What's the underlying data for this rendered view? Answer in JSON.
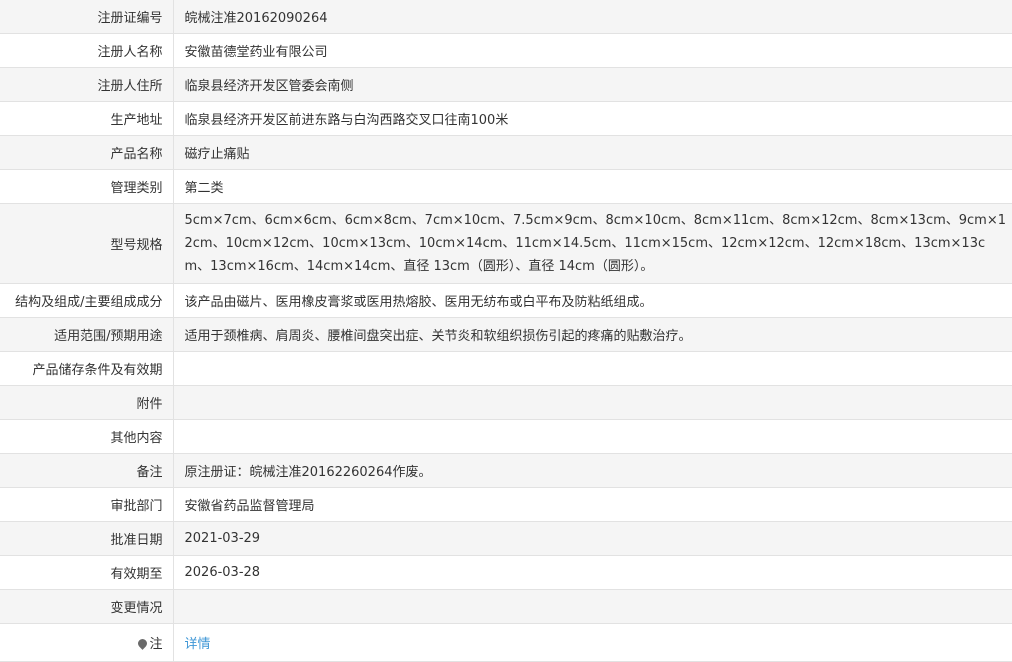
{
  "rows": [
    {
      "label": "注册证编号",
      "value": "皖械注准20162090264"
    },
    {
      "label": "注册人名称",
      "value": "安徽苗德堂药业有限公司"
    },
    {
      "label": "注册人住所",
      "value": "临泉县经济开发区管委会南侧"
    },
    {
      "label": "生产地址",
      "value": "临泉县经济开发区前进东路与白沟西路交叉口往南100米"
    },
    {
      "label": "产品名称",
      "value": "磁疗止痛贴"
    },
    {
      "label": "管理类别",
      "value": "第二类"
    },
    {
      "label": "型号规格",
      "value": "5cm×7cm、6cm×6cm、6cm×8cm、7cm×10cm、7.5cm×9cm、8cm×10cm、8cm×11cm、8cm×12cm、8cm×13cm、9cm×12cm、10cm×12cm、10cm×13cm、10cm×14cm、11cm×14.5cm、11cm×15cm、12cm×12cm、12cm×18cm、13cm×13cm、13cm×16cm、14cm×14cm、直径 13cm（圆形）、直径 14cm（圆形）。"
    },
    {
      "label": "结构及组成/主要组成成分",
      "value": "该产品由磁片、医用橡皮膏浆或医用热熔胶、医用无纺布或白平布及防粘纸组成。"
    },
    {
      "label": "适用范围/预期用途",
      "value": "适用于颈椎病、肩周炎、腰椎间盘突出症、关节炎和软组织损伤引起的疼痛的贴敷治疗。"
    },
    {
      "label": "产品储存条件及有效期",
      "value": ""
    },
    {
      "label": "附件",
      "value": ""
    },
    {
      "label": "其他内容",
      "value": ""
    },
    {
      "label": "备注",
      "value": "原注册证：皖械注准20162260264作废。"
    },
    {
      "label": "审批部门",
      "value": "安徽省药品监督管理局"
    },
    {
      "label": "批准日期",
      "value": "2021-03-29"
    },
    {
      "label": "有效期至",
      "value": "2026-03-28"
    },
    {
      "label": "变更情况",
      "value": ""
    }
  ],
  "note_row": {
    "label": "注",
    "icon": "map-pin-icon",
    "link_text": "详情",
    "link_color": "#3d96d6"
  }
}
